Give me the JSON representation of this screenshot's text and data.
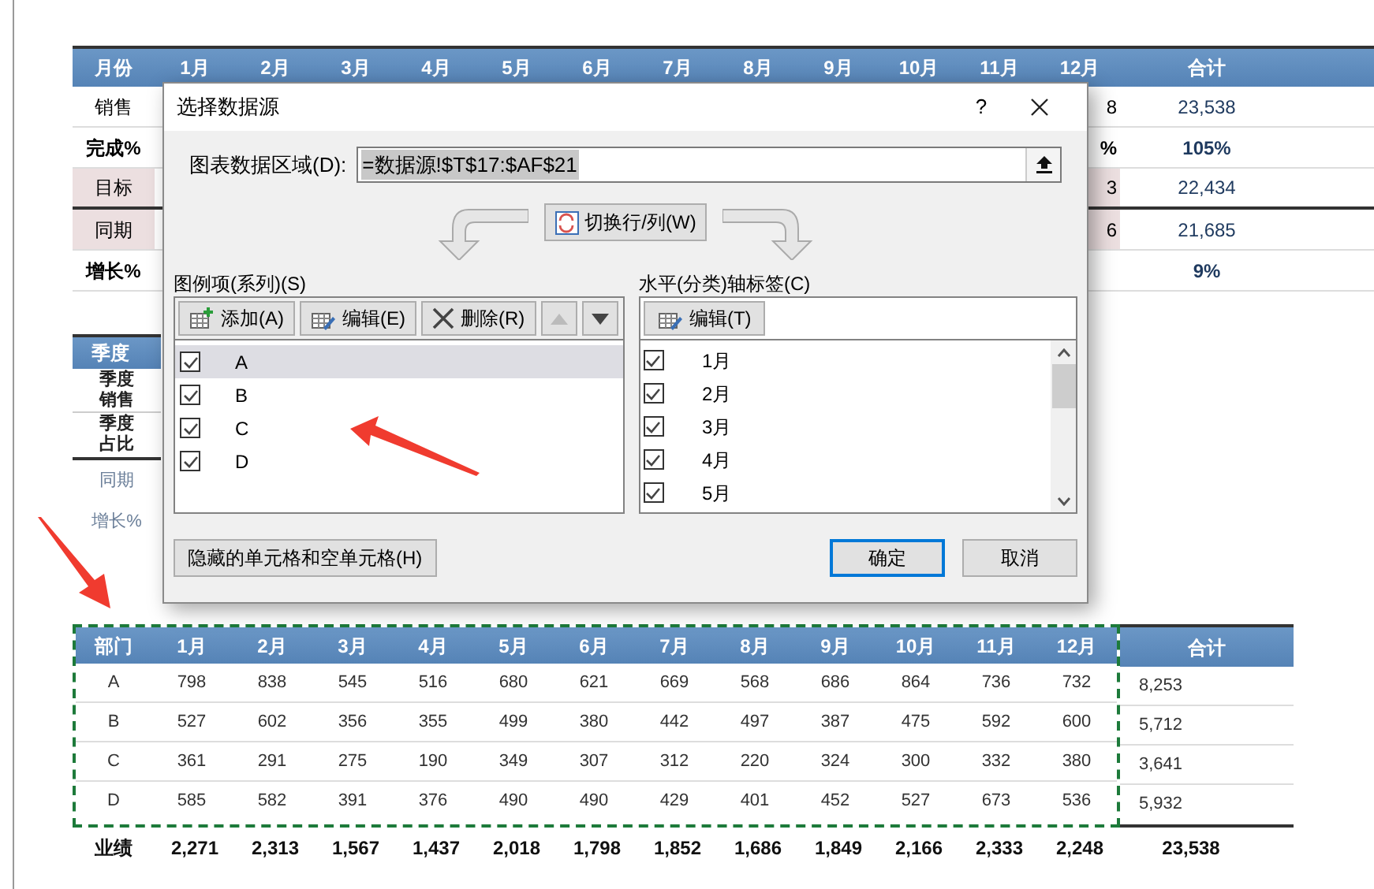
{
  "top_table": {
    "columns": [
      "月份",
      "1月",
      "2月",
      "3月",
      "4月",
      "5月",
      "6月",
      "7月",
      "8月",
      "9月",
      "10月",
      "11月",
      "12月",
      "合计"
    ],
    "rows": [
      {
        "label": "销售",
        "fragment": "8",
        "total": "23,538",
        "bold": false,
        "shaded": false
      },
      {
        "label": "完成%",
        "fragment": "%",
        "total": "105%",
        "bold": true,
        "shaded": false
      },
      {
        "label": "目标",
        "fragment": "3",
        "total": "22,434",
        "bold": false,
        "shaded": true
      },
      {
        "label": "同期",
        "fragment": "6",
        "total": "21,685",
        "bold": false,
        "shaded": true
      },
      {
        "label": "增长%",
        "fragment": "",
        "total": "9%",
        "bold": true,
        "shaded": false
      }
    ]
  },
  "quarter_table": {
    "header": "季度",
    "rows": [
      {
        "lines": [
          "季度",
          "销售"
        ],
        "muted": false
      },
      {
        "lines": [
          "季度",
          "占比"
        ],
        "muted": false
      },
      {
        "lines": [
          "同期"
        ],
        "muted": true
      },
      {
        "lines": [
          "增长%"
        ],
        "muted": true
      }
    ]
  },
  "dept_table": {
    "columns": [
      "部门",
      "1月",
      "2月",
      "3月",
      "4月",
      "5月",
      "6月",
      "7月",
      "8月",
      "9月",
      "10月",
      "11月",
      "12月",
      "合计"
    ],
    "rows": [
      {
        "name": "A",
        "values": [
          "798",
          "838",
          "545",
          "516",
          "680",
          "621",
          "669",
          "568",
          "686",
          "864",
          "736",
          "732"
        ],
        "total": "8,253"
      },
      {
        "name": "B",
        "values": [
          "527",
          "602",
          "356",
          "355",
          "499",
          "380",
          "442",
          "497",
          "387",
          "475",
          "592",
          "600"
        ],
        "total": "5,712"
      },
      {
        "name": "C",
        "values": [
          "361",
          "291",
          "275",
          "190",
          "349",
          "307",
          "312",
          "220",
          "324",
          "300",
          "332",
          "380"
        ],
        "total": "3,641"
      },
      {
        "name": "D",
        "values": [
          "585",
          "582",
          "391",
          "376",
          "490",
          "490",
          "429",
          "401",
          "452",
          "527",
          "673",
          "536"
        ],
        "total": "5,932"
      }
    ],
    "footer": {
      "label": "业绩",
      "values": [
        "2,271",
        "2,313",
        "1,567",
        "1,437",
        "2,018",
        "1,798",
        "1,852",
        "1,686",
        "1,849",
        "2,166",
        "2,333",
        "2,248"
      ],
      "total": "23,538"
    }
  },
  "dialog": {
    "title": "选择数据源",
    "help": "?",
    "range_label": "图表数据区域(D):",
    "range_value": "=数据源!$T$17:$AF$21",
    "swap_button": "切换行/列(W)",
    "series_label": "图例项(系列)(S)",
    "series_buttons": [
      {
        "kind": "add",
        "label": "添加(A)",
        "disabled": false
      },
      {
        "kind": "edit",
        "label": "编辑(E)",
        "disabled": false
      },
      {
        "kind": "delete",
        "label": "删除(R)",
        "disabled": false
      },
      {
        "kind": "move_up",
        "disabled": true
      },
      {
        "kind": "move_down",
        "disabled": false
      }
    ],
    "series": [
      {
        "name": "A",
        "checked": true,
        "selected": true
      },
      {
        "name": "B",
        "checked": true,
        "selected": false
      },
      {
        "name": "C",
        "checked": true,
        "selected": false
      },
      {
        "name": "D",
        "checked": true,
        "selected": false
      }
    ],
    "axis_label": "水平(分类)轴标签(C)",
    "axis_edit_button": "编辑(T)",
    "axis_items": [
      {
        "label": "1月",
        "checked": true
      },
      {
        "label": "2月",
        "checked": true
      },
      {
        "label": "3月",
        "checked": true
      },
      {
        "label": "4月",
        "checked": true
      },
      {
        "label": "5月",
        "checked": true
      }
    ],
    "hidden_cells_button": "隐藏的单元格和空单元格(H)",
    "ok_button": "确定",
    "cancel_button": "取消"
  }
}
